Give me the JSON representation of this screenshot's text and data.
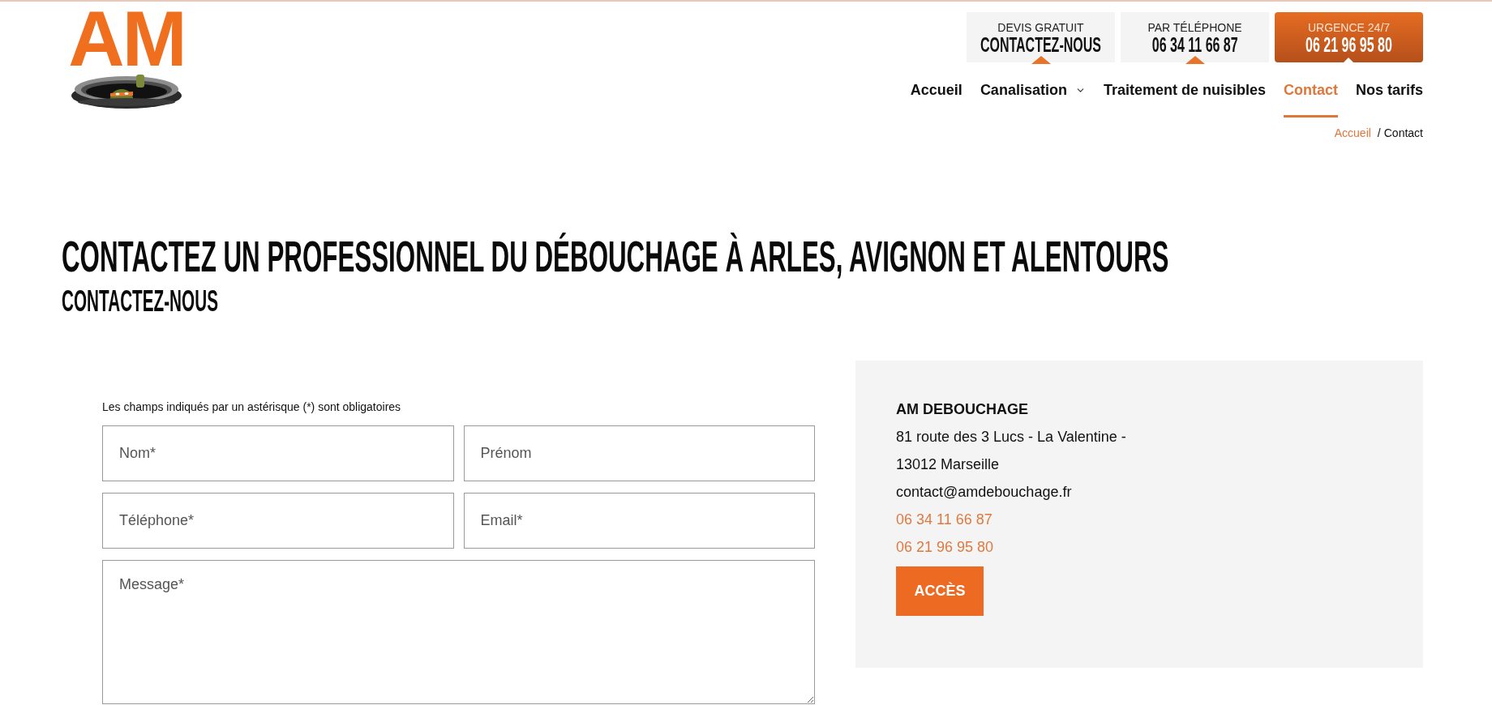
{
  "logo": {
    "text": "AM"
  },
  "header_buttons": [
    {
      "kind": "plain",
      "label": "DEVIS GRATUIT",
      "value": "CONTACTEZ-NOUS"
    },
    {
      "kind": "plain",
      "label": "PAR TÉLÉPHONE",
      "value": "06 34 11 66 87"
    },
    {
      "kind": "urgent",
      "label": "URGENCE 24/7",
      "value": "06 21 96 95 80"
    }
  ],
  "nav": [
    {
      "label": "Accueil",
      "selected": false,
      "has_dropdown": false
    },
    {
      "label": "Canalisation",
      "selected": false,
      "has_dropdown": true
    },
    {
      "label": "Traitement de nuisibles",
      "selected": false,
      "has_dropdown": false
    },
    {
      "label": "Contact",
      "selected": true,
      "has_dropdown": false
    },
    {
      "label": "Nos tarifs",
      "selected": false,
      "has_dropdown": false
    }
  ],
  "breadcrumb": {
    "separator": "/",
    "items": [
      {
        "label": "Accueil",
        "current": false
      },
      {
        "label": "Contact",
        "current": true
      }
    ]
  },
  "heading": "CONTACTEZ UN PROFESSIONNEL DU DÉBOUCHAGE À ARLES, AVIGNON ET ALENTOURS",
  "subheading": "CONTACTEZ-NOUS",
  "form": {
    "note": "Les champs indiqués par un astérisque (*) sont obligatoires",
    "fields": [
      {
        "kind": "input",
        "placeholder": "Nom*"
      },
      {
        "kind": "input",
        "placeholder": "Prénom"
      },
      {
        "kind": "input",
        "placeholder": "Téléphone*"
      },
      {
        "kind": "input",
        "placeholder": "Email*"
      },
      {
        "kind": "textarea",
        "placeholder": "Message*"
      }
    ]
  },
  "contact_card": {
    "company": "AM DEBOUCHAGE",
    "lines": [
      {
        "kind": "address",
        "text": "81 route des 3 Lucs - La Valentine -"
      },
      {
        "kind": "address",
        "text": "13012 Marseille"
      },
      {
        "kind": "email",
        "text": "contact@amdebouchage.fr"
      },
      {
        "kind": "phone",
        "text": "06 34 11 66 87"
      },
      {
        "kind": "phone",
        "text": "06 21 96 95 80"
      }
    ],
    "button": "ACCÈS"
  }
}
